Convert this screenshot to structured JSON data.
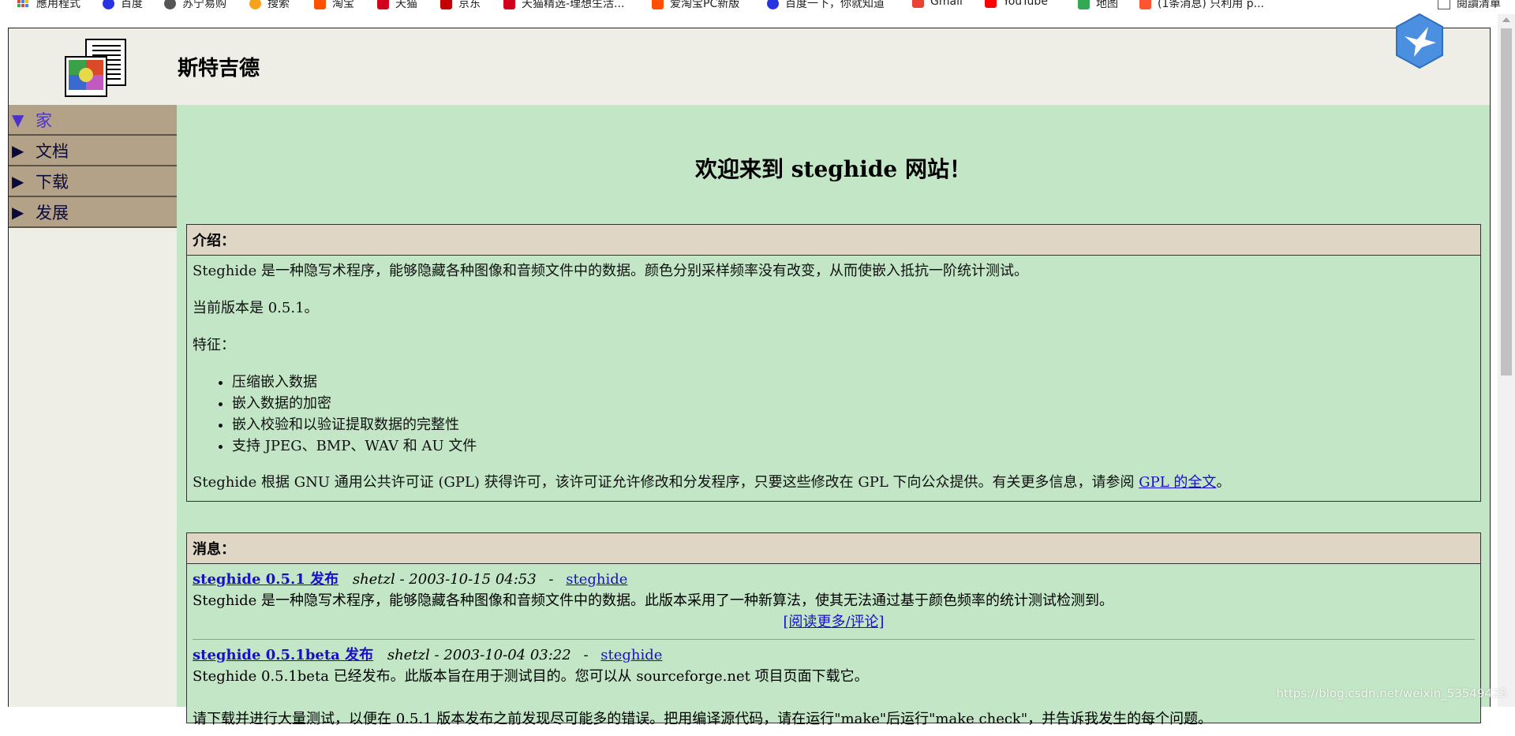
{
  "bookmarks": {
    "items": [
      {
        "label": "應用程式",
        "icon": "apps-grid-icon"
      },
      {
        "label": "百度",
        "icon": "baidu-icon"
      },
      {
        "label": "苏宁易购",
        "icon": "suning-icon"
      },
      {
        "label": "搜索",
        "icon": "search-icon"
      },
      {
        "label": "淘宝",
        "icon": "taobao-icon"
      },
      {
        "label": "天猫",
        "icon": "tmall-icon"
      },
      {
        "label": "京东",
        "icon": "jd-icon"
      },
      {
        "label": "天猫精选-理想生活...",
        "icon": "tmall-icon"
      },
      {
        "label": "爱淘宝PC新版",
        "icon": "taobao-icon"
      },
      {
        "label": "百度一下，你就知道",
        "icon": "baidu-icon"
      },
      {
        "label": "Gmail",
        "icon": "gmail-icon"
      },
      {
        "label": "YouTube",
        "icon": "youtube-icon"
      },
      {
        "label": "地图",
        "icon": "maps-icon"
      },
      {
        "label": "(1条消息) 只利用 p...",
        "icon": "csdn-icon"
      }
    ],
    "reading_list": "閱讀清單"
  },
  "header": {
    "title": "斯特吉德"
  },
  "sidebar": {
    "items": [
      {
        "label": "家",
        "active": true,
        "arrow": "▼"
      },
      {
        "label": "文档",
        "active": false,
        "arrow": "▶"
      },
      {
        "label": "下载",
        "active": false,
        "arrow": "▶"
      },
      {
        "label": "发展",
        "active": false,
        "arrow": "▶"
      }
    ]
  },
  "main": {
    "welcome": "欢迎来到 steghide 网站！",
    "intro": {
      "heading": "介绍：",
      "p1": "Steghide 是一种隐写术程序，能够隐藏各种图像和音频文件中的数据。颜色分别采样频率没有改变，从而使嵌入抵抗一阶统计测试。",
      "p2": "当前版本是 0.5.1。",
      "p3": "特征：",
      "features": [
        "压缩嵌入数据",
        "嵌入数据的加密",
        "嵌入校验和以验证提取数据的完整性",
        "支持 JPEG、BMP、WAV 和 AU 文件"
      ],
      "license_text": "Steghide 根据 GNU 通用公共许可证 (GPL) 获得许可，该许可证允许修改和分发程序，只要这些修改在 GPL 下向公众提供。有关更多信息，请参阅 ",
      "license_link": "GPL 的全文",
      "license_end": "。"
    },
    "news": {
      "heading": "消息：",
      "items": [
        {
          "title": "steghide 0.5.1 发布",
          "meta": "shetzl - 2003-10-15 04:53",
          "sep": "-",
          "tag": "steghide",
          "body": "Steghide 是一种隐写术程序，能够隐藏各种图像和音频文件中的数据。此版本采用了一种新算法，使其无法通过基于颜色频率的统计测试检测到。",
          "more": "[阅读更多/评论]"
        },
        {
          "title": "steghide 0.5.1beta 发布",
          "meta": "shetzl - 2003-10-04 03:22",
          "sep": "-",
          "tag": "steghide",
          "body": "Steghide 0.5.1beta 已经发布。此版本旨在用于测试目的。您可以从 sourceforge.net 项目页面下载它。",
          "body2": "请下载并进行大量测试，以便在 0.5.1 版本发布之前发现尽可能多的错误。把用编译源代码，请在运行\"make\"后运行\"make check\"，并告诉我发生的每个问题。"
        }
      ]
    }
  },
  "watermark": "https://blog.csdn.net/weixin_53549425",
  "colors": {
    "main_bg": "#c2e6c6",
    "sidebar_item_bg": "#b3a287",
    "header_bg": "#eeede6",
    "box_head_bg": "#dfd6c5",
    "link": "#1a0dcc",
    "active_nav": "#4a32c8"
  }
}
